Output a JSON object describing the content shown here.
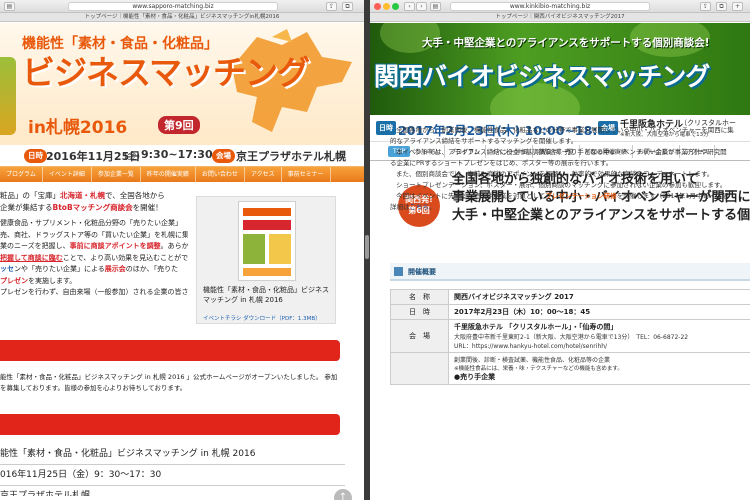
{
  "left": {
    "url": "www.sapporo-matching.biz",
    "breadcrumb": "トップページ｜機能性「素材・食品・化粧品」ビジネスマッチングin札幌2016",
    "hero": {
      "subtitle": "機能性「素材・食品・化粧品」",
      "title": "ビジネスマッチング",
      "title2": "in札幌2016",
      "number": "第9回"
    },
    "info": {
      "date_label": "日時",
      "date": "2016年11月25日",
      "weekday": "(金)",
      "time": "9:30~17:30",
      "venue_label": "会場",
      "venue": "京王プラザホテル札幌"
    },
    "nav": [
      "プログラム",
      "イベント詳細",
      "参加企業一覧",
      "昨年の開催実績",
      "お問い合わせ",
      "アクセス",
      "事前セミナー"
    ],
    "intro": {
      "l1a": "粧品」の「宝庫」",
      "l1b": "北海道・札幌",
      "l1c": "で、全国各地から",
      "l2a": "企業が集結する",
      "l2b": "BtoBマッチング商談会",
      "l2c": "を開催！",
      "l3": "健康食品・サプリメント・化粧品分野の「売りたい企業」",
      "l4": "売、商社、ドラッグストア等の「買いたい企業」を札幌に集",
      "l5a": "業のニーズを把握し、",
      "l5b": "事前に商談アポイントを調整",
      "l5c": "。あらか",
      "l6a": "把握して商談に臨む",
      "l6b": "ことで、より高い効果を見込むことがで",
      "l7a": "ッセ",
      "l7b": "ンや「売りたい企業」による",
      "l7c": "展示会",
      "l7d": "のほか、「売りた",
      "l8a": "プレゼン",
      "l8b": "を実施します。",
      "l9": "プレゼンを行わず、自由来場（一般参加）される企業の皆さ"
    },
    "card": {
      "text": "機能性「素材・食品・化粧品」ビジネスマッチング in 札幌 2016",
      "link": "イベントチラシ ダウンロード（PDF：1.3MB）"
    },
    "news": {
      "l1": "能性「素材・食品・化粧品」ビジネスマッチング in 札幌 2016 」公式ホームページがオープンいたしました。 参加",
      "l2": "を募集しております。皆様の参加を心よりお待ちしております。"
    },
    "event": {
      "name": "能性「素材・食品・化粧品」ビジネスマッチング in 札幌 2016",
      "date": "016年11月25日（金）9：30～17：30",
      "venue": "京王プラザホテル札幌"
    },
    "scroll_top_icon": "↑"
  },
  "right": {
    "url": "www.kinkibio-matching.biz",
    "breadcrumb": "トップページ｜関西バイオビジネスマッチング2017",
    "hero": {
      "tagline": "大手・中堅企業とのアライアンスをサポートする個別商談会!",
      "title": "関西バイオビジネスマッチング"
    },
    "date": {
      "label": "日時",
      "value": "2017年2月23日(木) 10:00~18:45",
      "venue_label": "会場",
      "venue": "千里阪急ホテル",
      "venue_hall": "（クリスタルホー",
      "access": "※新大阪、大阪空港から電車で13分"
    },
    "nav": [
      "TOP",
      "参加申込",
      "プログラム",
      "イベント詳細",
      "参加企業一覧",
      "前回の開催実績",
      "お問い合わせ",
      "アクセス"
    ],
    "banner": {
      "badge_l1": "関西発!",
      "badge_l2": "第6回",
      "l1": "全国各地から独創的なバイオ技術を用いて",
      "l2": "事業展開している中小・バイオベンチャーが関西に集",
      "l3": "大手・中堅企業とのアライアンスをサポートする個別"
    },
    "desc": {
      "l1": "全国各地から、創業間後、機能性食品、化粧品などの分野で事業を展開している中小・バイオベンチャーを関西に集",
      "l2": "的なアライアンス締結をサポートするマッチングを開催します。",
      "l3": "本イベントでは、アライアンス締結に役立つ基調講演や、売り手となる中小・ベンチャー企業が事業方針や研究開",
      "l4": "る企業にPRするショートプレゼンをはじめ、ポスター等の展示を行います。",
      "l5": "また、個別商談会では、事前に商談のアポイントを調整し、効率的で効果的な商談をコーディネートします。",
      "l6": "ショートプレゼンテーション、ポスター・展示、個別商談のマッチングに参加されない企業の参加も歓迎します。",
      "l7a": "今回はイベントに先立ち、売り手企業を対象として",
      "l7b": "プレゼンテーション研修",
      "l7c": "を開催します（2017年1月中旬・大阪",
      "l8a": "詳細は",
      "l8b": "こちら",
      "l8c": "。"
    },
    "section": "開催概要",
    "table": {
      "name_label": "名　称",
      "name": "関西バイオビジネスマッチング 2017",
      "date_label": "日　時",
      "date": "2017年2月23日（木）10：00～18：45",
      "venue_label": "会　場",
      "venue1": "千里阪急ホテル 「クリスタルホール」・「仙寿の間」",
      "venue2": "大阪府豊中市新千里東町2-1（新大阪、大阪空港から電車で13分）　TEL：06-6872-22",
      "venue3": "URL：https://www.hankyu-hotel.com/hotel/senrihh/",
      "c1": "創業間後、診断・検査試薬、機能性食品、化粧品等の企業",
      "c2": "※機能性食品には、栄養・味・テクスチャーなどの機能も含めます。",
      "c3": "●売り手企業"
    }
  }
}
